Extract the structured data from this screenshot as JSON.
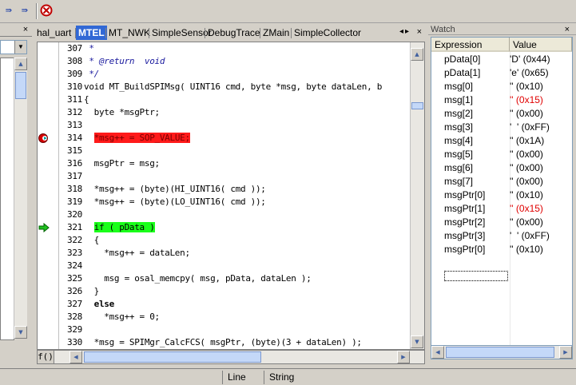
{
  "toolbar": {
    "step_over_glyph": "⇛",
    "run_cursor_glyph": "⇛",
    "icons": [
      "step-over-icon",
      "run-to-cursor-icon",
      "stop-debug-icon"
    ]
  },
  "left_panel": {
    "close_glyph": "×"
  },
  "tabs": [
    {
      "label": "hal_uart",
      "active": false
    },
    {
      "label": "MTEL",
      "active": true
    },
    {
      "label": "MT_NWK",
      "active": false
    },
    {
      "label": "SimpleSensor",
      "active": false
    },
    {
      "label": "DebugTrace",
      "active": false
    },
    {
      "label": "ZMain",
      "active": false
    },
    {
      "label": "SimpleCollector",
      "active": false
    }
  ],
  "tabs_nav": {
    "arrows": "◂▸",
    "close": "×"
  },
  "editor": {
    "function_button": "f()",
    "lines": [
      {
        "num": "307",
        "text": " *",
        "style": "comment"
      },
      {
        "num": "308",
        "text": " * @return  void",
        "style": "comment"
      },
      {
        "num": "309",
        "text": " */",
        "style": "comment"
      },
      {
        "num": "310",
        "text": "void MT_BuildSPIMsg( UINT16 cmd, byte *msg, byte dataLen, b",
        "style": "code"
      },
      {
        "num": "311",
        "text": "{",
        "style": "code"
      },
      {
        "num": "312",
        "text": "  byte *msgPtr;",
        "style": "code"
      },
      {
        "num": "313",
        "text": "",
        "style": "code"
      },
      {
        "num": "314",
        "text": "*msg++ = SOP_VALUE;",
        "indent": "  ",
        "style": "breakpoint"
      },
      {
        "num": "315",
        "text": "",
        "style": "code"
      },
      {
        "num": "316",
        "text": "  msgPtr = msg;",
        "style": "code"
      },
      {
        "num": "317",
        "text": "",
        "style": "code"
      },
      {
        "num": "318",
        "text": "  *msg++ = (byte)(HI_UINT16( cmd ));",
        "style": "code"
      },
      {
        "num": "319",
        "text": "  *msg++ = (byte)(LO_UINT16( cmd ));",
        "style": "code"
      },
      {
        "num": "320",
        "text": "",
        "style": "code"
      },
      {
        "num": "321",
        "text": "if ( pData )",
        "indent": "  ",
        "style": "current"
      },
      {
        "num": "322",
        "text": "  {",
        "style": "code"
      },
      {
        "num": "323",
        "text": "    *msg++ = dataLen;",
        "style": "code"
      },
      {
        "num": "324",
        "text": "",
        "style": "code"
      },
      {
        "num": "325",
        "text": "    msg = osal_memcpy( msg, pData, dataLen );",
        "style": "code"
      },
      {
        "num": "326",
        "text": "  }",
        "style": "code"
      },
      {
        "num": "327",
        "text": "  else",
        "style": "keyword"
      },
      {
        "num": "328",
        "text": "    *msg++ = 0;",
        "style": "code"
      },
      {
        "num": "329",
        "text": "",
        "style": "code"
      },
      {
        "num": "330",
        "text": "  *msg = SPIMgr_CalcFCS( msgPtr, (byte)(3 + dataLen) );",
        "style": "code"
      }
    ],
    "colors": {
      "breakpoint_bg": "#ff1a1a",
      "current_bg": "#1aff1a"
    }
  },
  "watch": {
    "title": "Watch",
    "close_glyph": "×",
    "columns": [
      "Expression",
      "Value"
    ],
    "rows": [
      {
        "expr": "pData[0]",
        "value": "'D' (0x44)",
        "changed": false
      },
      {
        "expr": "pData[1]",
        "value": "'e' (0x65)",
        "changed": false
      },
      {
        "expr": "msg[0]",
        "value": "'' (0x10)",
        "changed": false
      },
      {
        "expr": "msg[1]",
        "value": "'' (0x15)",
        "changed": true
      },
      {
        "expr": "msg[2]",
        "value": "'' (0x00)",
        "changed": false
      },
      {
        "expr": "msg[3]",
        "value": "'  ' (0xFF)",
        "changed": false
      },
      {
        "expr": "msg[4]",
        "value": "'' (0x1A)",
        "changed": false
      },
      {
        "expr": "msg[5]",
        "value": "'' (0x00)",
        "changed": false
      },
      {
        "expr": "msg[6]",
        "value": "'' (0x00)",
        "changed": false
      },
      {
        "expr": "msg[7]",
        "value": "'' (0x00)",
        "changed": false
      },
      {
        "expr": "msgPtr[0]",
        "value": "'' (0x10)",
        "changed": false
      },
      {
        "expr": "msgPtr[1]",
        "value": "'' (0x15)",
        "changed": true
      },
      {
        "expr": "msgPtr[2]",
        "value": "'' (0x00)",
        "changed": false
      },
      {
        "expr": "msgPtr[3]",
        "value": "'  ' (0xFF)",
        "changed": false
      },
      {
        "expr": "msgPtr[0]",
        "value": "'' (0x10)",
        "changed": false
      }
    ]
  },
  "statusbar": {
    "line": "Line",
    "string": "String"
  }
}
